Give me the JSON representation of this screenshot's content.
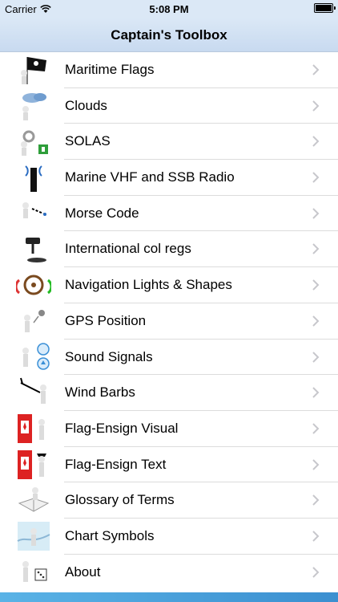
{
  "status": {
    "carrier": "Carrier",
    "time": "5:08 PM"
  },
  "nav": {
    "title": "Captain's Toolbox"
  },
  "items": [
    {
      "label": "Maritime Flags",
      "icon": "pirate-flag-figure-icon"
    },
    {
      "label": "Clouds",
      "icon": "clouds-figure-icon"
    },
    {
      "label": "SOLAS",
      "icon": "solas-figure-icon"
    },
    {
      "label": "Marine VHF and SSB Radio",
      "icon": "radio-figure-icon"
    },
    {
      "label": "Morse Code",
      "icon": "morse-figure-icon"
    },
    {
      "label": "International col regs",
      "icon": "gavel-figure-icon"
    },
    {
      "label": "Navigation Lights & Shapes",
      "icon": "ship-wheel-figure-icon"
    },
    {
      "label": "GPS Position",
      "icon": "satellite-figure-icon"
    },
    {
      "label": "Sound Signals",
      "icon": "sound-signals-figure-icon"
    },
    {
      "label": "Wind Barbs",
      "icon": "wind-barb-figure-icon"
    },
    {
      "label": "Flag-Ensign Visual",
      "icon": "canada-flag-figure-icon"
    },
    {
      "label": "Flag-Ensign Text",
      "icon": "canada-flag-text-figure-icon"
    },
    {
      "label": "Glossary of Terms",
      "icon": "book-figure-icon"
    },
    {
      "label": "Chart Symbols",
      "icon": "chart-figure-icon"
    },
    {
      "label": "About",
      "icon": "dice-figure-icon"
    }
  ],
  "colors": {
    "accent": "#3b8fd0",
    "navbar": "#d3e3f4"
  }
}
